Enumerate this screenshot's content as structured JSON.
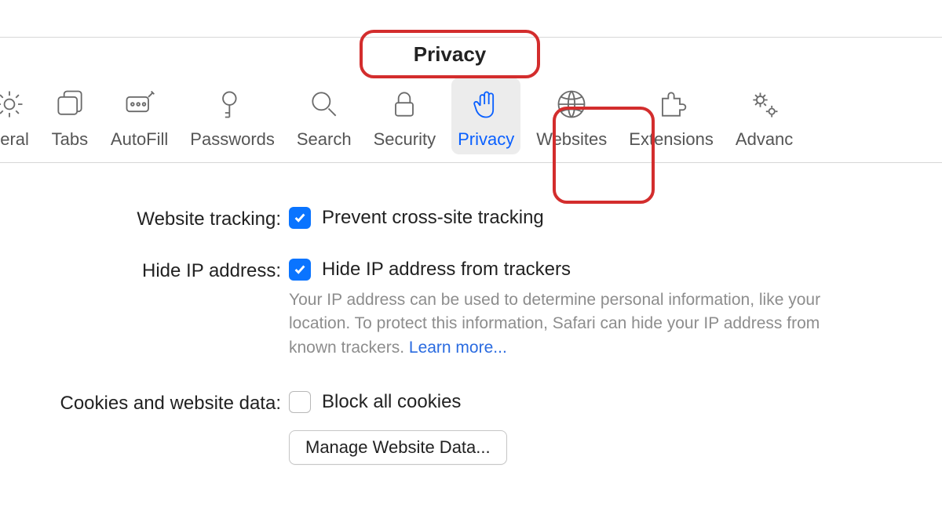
{
  "window": {
    "title": "Privacy"
  },
  "tabs": {
    "general": {
      "label": "neral"
    },
    "tabs": {
      "label": "Tabs"
    },
    "autofill": {
      "label": "AutoFill"
    },
    "passwords": {
      "label": "Passwords"
    },
    "search": {
      "label": "Search"
    },
    "security": {
      "label": "Security"
    },
    "privacy": {
      "label": "Privacy"
    },
    "websites": {
      "label": "Websites"
    },
    "extensions": {
      "label": "Extensions"
    },
    "advanced": {
      "label": "Advanc"
    }
  },
  "settings": {
    "tracking_label": "Website tracking:",
    "tracking_check_label": "Prevent cross-site tracking",
    "tracking_checked": true,
    "hideip_label": "Hide IP address:",
    "hideip_check_label": "Hide IP address from trackers",
    "hideip_checked": true,
    "hideip_desc": "Your IP address can be used to determine personal information, like your location. To protect this information, Safari can hide your IP address from known trackers. ",
    "hideip_learn": "Learn more...",
    "cookies_label": "Cookies and website data:",
    "cookies_check_label": "Block all cookies",
    "cookies_checked": false,
    "manage_btn": "Manage Website Data..."
  }
}
